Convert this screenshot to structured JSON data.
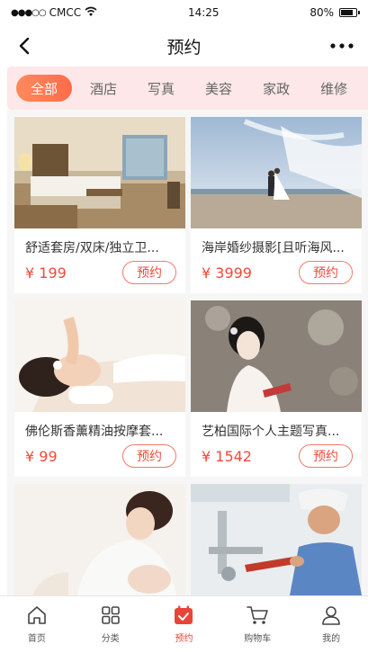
{
  "status_bar": {
    "carrier": "CMCC",
    "signal_dots": "●●●○○",
    "time": "14:25",
    "battery": "80%",
    "battery_level": 0.8
  },
  "nav": {
    "title": "预约",
    "more": "•••"
  },
  "categories": [
    {
      "label": "全部",
      "active": true
    },
    {
      "label": "酒店",
      "active": false
    },
    {
      "label": "写真",
      "active": false
    },
    {
      "label": "美容",
      "active": false
    },
    {
      "label": "家政",
      "active": false
    },
    {
      "label": "维修",
      "active": false
    }
  ],
  "products": [
    {
      "name": "舒适套房/双床/独立卫...",
      "price": "¥ 199",
      "button": "预约",
      "image": "hotel-room"
    },
    {
      "name": "海岸婚纱摄影[且听海风...",
      "price": "¥ 3999",
      "button": "预约",
      "image": "beach-wedding"
    },
    {
      "name": "佛伦斯香薰精油按摩套...",
      "price": "¥ 99",
      "button": "预约",
      "image": "spa-massage"
    },
    {
      "name": "艺柏国际个人主题写真...",
      "price": "¥ 1542",
      "button": "预约",
      "image": "portrait-photo"
    },
    {
      "name": "",
      "price": "",
      "button": "",
      "image": "mother-baby"
    },
    {
      "name": "",
      "price": "",
      "button": "",
      "image": "plumber-repair"
    }
  ],
  "tabbar": [
    {
      "label": "首页",
      "icon": "home-icon",
      "active": false
    },
    {
      "label": "分类",
      "icon": "grid-icon",
      "active": false
    },
    {
      "label": "预约",
      "icon": "calendar-check-icon",
      "active": true
    },
    {
      "label": "购物车",
      "icon": "cart-icon",
      "active": false
    },
    {
      "label": "我的",
      "icon": "user-icon",
      "active": false
    }
  ],
  "colors": {
    "accent": "#f04a3a",
    "tab_bg": "#fde7e8",
    "active_tab_gradient": [
      "#ff8a5c",
      "#ff6b4a"
    ]
  }
}
